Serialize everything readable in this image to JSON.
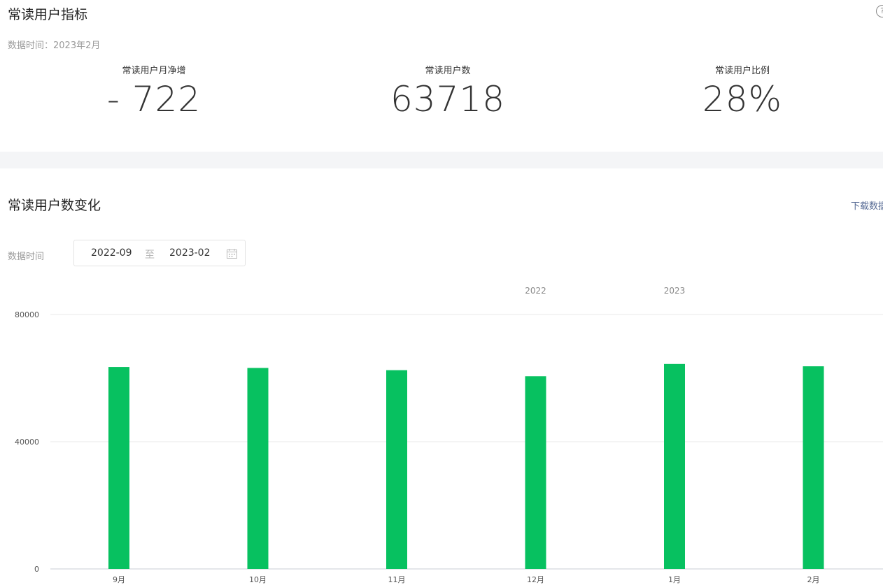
{
  "summary": {
    "title": "常读用户指标",
    "data_time": "数据时间：2023年2月",
    "metrics": [
      {
        "label": "常读用户月净增",
        "value": "- 722"
      },
      {
        "label": "常读用户数",
        "value": "63718"
      },
      {
        "label": "常读用户比例",
        "value": "28%"
      }
    ]
  },
  "trend": {
    "title": "常读用户数变化",
    "download_label": "下载数据",
    "range_label": "数据时间",
    "range_start": "2022-09",
    "range_separator": "至",
    "range_end": "2023-02"
  },
  "colors": {
    "bar": "#07c160",
    "grid": "#e8e8e8",
    "link": "#576b95"
  },
  "chart_data": {
    "type": "bar",
    "categories": [
      "9月",
      "10月",
      "11月",
      "12月",
      "1月",
      "2月"
    ],
    "year_labels": [
      {
        "text": "2022",
        "category_index": 3
      },
      {
        "text": "2023",
        "category_index": 4
      }
    ],
    "series": [
      {
        "values": [
          63500,
          63200,
          62500,
          60600,
          64440,
          63718
        ]
      }
    ],
    "ylim": [
      0,
      80000
    ],
    "yticks": [
      0,
      40000,
      80000
    ],
    "grid": true
  }
}
